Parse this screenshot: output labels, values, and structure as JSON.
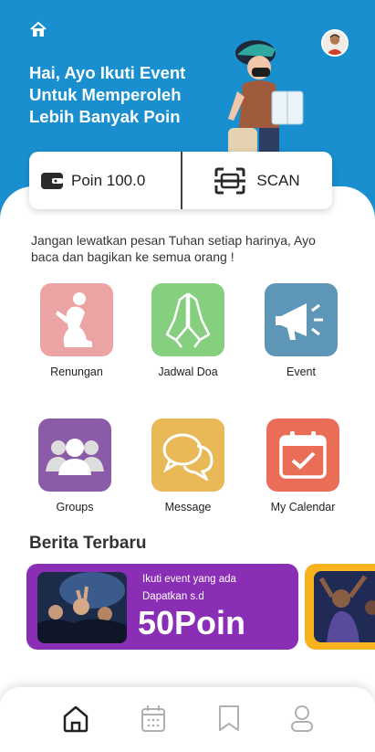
{
  "header": {
    "greeting": "Hai, Ayo Ikuti Event Untuk Memperoleh Lebih Banyak Poin",
    "color": "#1a8fd0"
  },
  "poin": {
    "label": "Poin 100.0",
    "scan_label": "SCAN"
  },
  "intro": "Jangan lewatkan pesan Tuhan setiap harinya, Ayo baca dan bagikan ke semua orang !",
  "menu": [
    {
      "label": "Renungan",
      "icon": "praying-person-icon",
      "color": "#eba3a3"
    },
    {
      "label": "Jadwal Doa",
      "icon": "praying-hands-icon",
      "color": "#85cf7f"
    },
    {
      "label": "Event",
      "icon": "megaphone-icon",
      "color": "#5e96b8"
    },
    {
      "label": "Groups",
      "icon": "group-icon",
      "color": "#8b5ba8"
    },
    {
      "label": "Message",
      "icon": "chat-bubbles-icon",
      "color": "#e8b956"
    },
    {
      "label": "My Calendar",
      "icon": "calendar-check-icon",
      "color": "#ea6d58"
    }
  ],
  "news": {
    "section_title": "Berita Terbaru",
    "card": {
      "line1": "Ikuti event yang ada",
      "line2": "Dapatkan s.d",
      "big": "50Poin",
      "color": "#8a2fb5"
    },
    "card2_color": "#f7b21e"
  },
  "bottom_nav": [
    {
      "icon": "home-icon",
      "active": true
    },
    {
      "icon": "calendar-icon",
      "active": false
    },
    {
      "icon": "bookmark-icon",
      "active": false
    },
    {
      "icon": "user-icon",
      "active": false
    }
  ]
}
